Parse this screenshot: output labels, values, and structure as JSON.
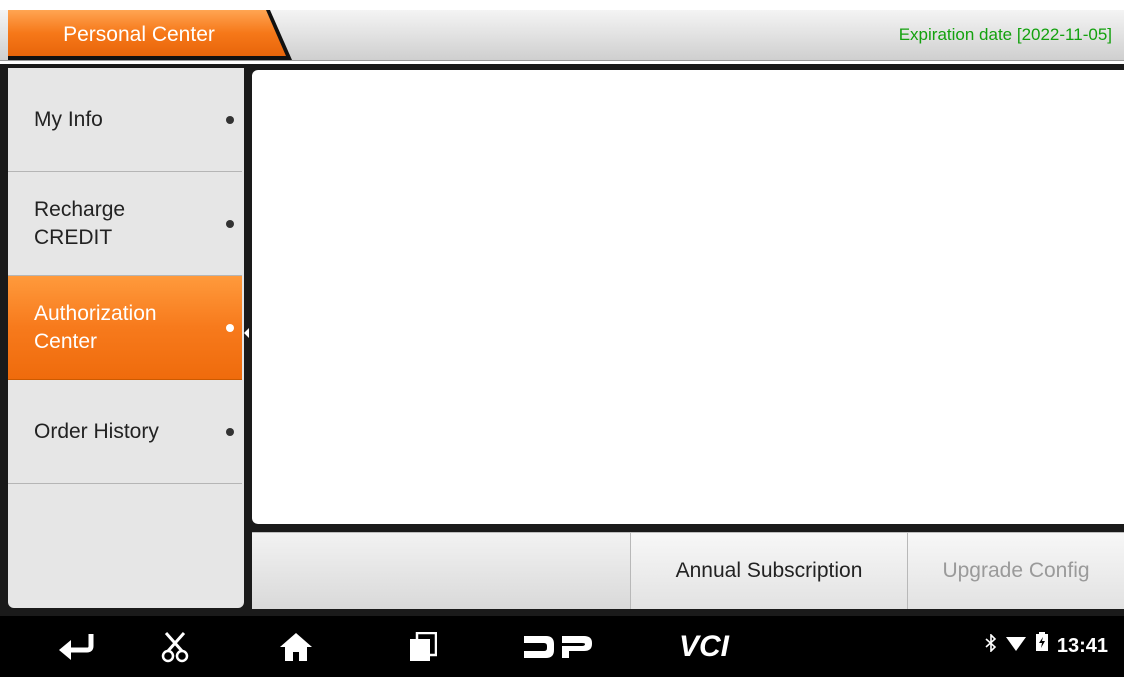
{
  "header": {
    "title": "Personal Center",
    "expiration": "Expiration date [2022-11-05]"
  },
  "sidebar": {
    "items": [
      {
        "label": "My Info",
        "active": false
      },
      {
        "label": "Recharge CREDIT",
        "active": false
      },
      {
        "label": "Authorization Center",
        "active": true
      },
      {
        "label": "Order History",
        "active": false
      }
    ]
  },
  "actions": {
    "annual_subscription": "Annual Subscription",
    "upgrade_config": "Upgrade Config"
  },
  "navbar": {
    "icons": [
      "back-icon",
      "scissors-icon",
      "home-icon",
      "recent-apps-icon",
      "dp-icon",
      "vci-icon"
    ],
    "vci_label": "VCI",
    "time": "13:41"
  },
  "colors": {
    "accent": "#f77a1c",
    "expiry": "#13a10e"
  }
}
